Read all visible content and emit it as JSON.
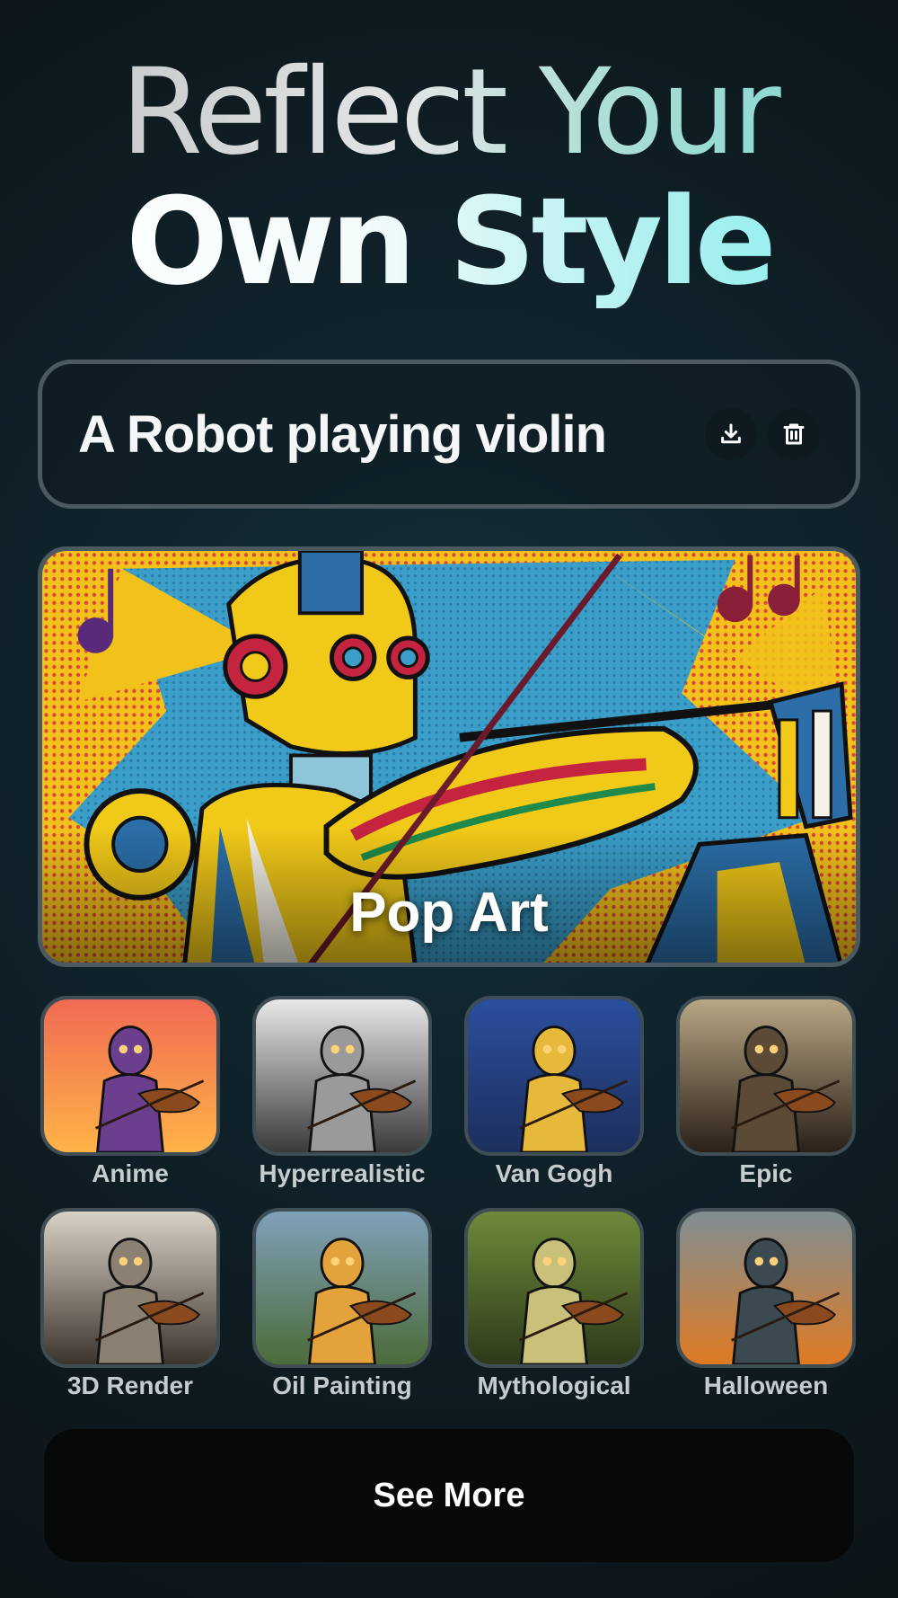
{
  "heading": {
    "line1": "Reflect Your",
    "line2": "Own Style"
  },
  "prompt": {
    "text": "A Robot playing violin",
    "download_icon": "download-icon",
    "delete_icon": "trash-icon"
  },
  "preview": {
    "style_label": "Pop Art"
  },
  "styles": [
    {
      "label": "Anime",
      "colors": [
        "#f06a53",
        "#6c3f8e",
        "#ffb347"
      ]
    },
    {
      "label": "Hyperrealistic",
      "colors": [
        "#e8e8e8",
        "#9a9a9a",
        "#3a3a3a"
      ]
    },
    {
      "label": "Van Gogh",
      "colors": [
        "#2b4f9e",
        "#e6b93a",
        "#1d2f5c"
      ]
    },
    {
      "label": "Epic",
      "colors": [
        "#b8a684",
        "#5a4a36",
        "#2a2018"
      ]
    },
    {
      "label": "3D Render",
      "colors": [
        "#d8d2c6",
        "#8b8173",
        "#3b352e"
      ]
    },
    {
      "label": "Oil Painting",
      "colors": [
        "#7fa0b8",
        "#e3a23a",
        "#4c6b3a"
      ]
    },
    {
      "label": "Mythological",
      "colors": [
        "#6e8a3a",
        "#c9c17a",
        "#2d3a1a"
      ]
    },
    {
      "label": "Halloween",
      "colors": [
        "#7e8e94",
        "#3b4a50",
        "#e07a22"
      ]
    }
  ],
  "see_more_label": "See More",
  "colors": {
    "background": "#0f2129",
    "border": "#4b5a61",
    "accent": "#86f2f0",
    "button_bg": "#070909"
  }
}
